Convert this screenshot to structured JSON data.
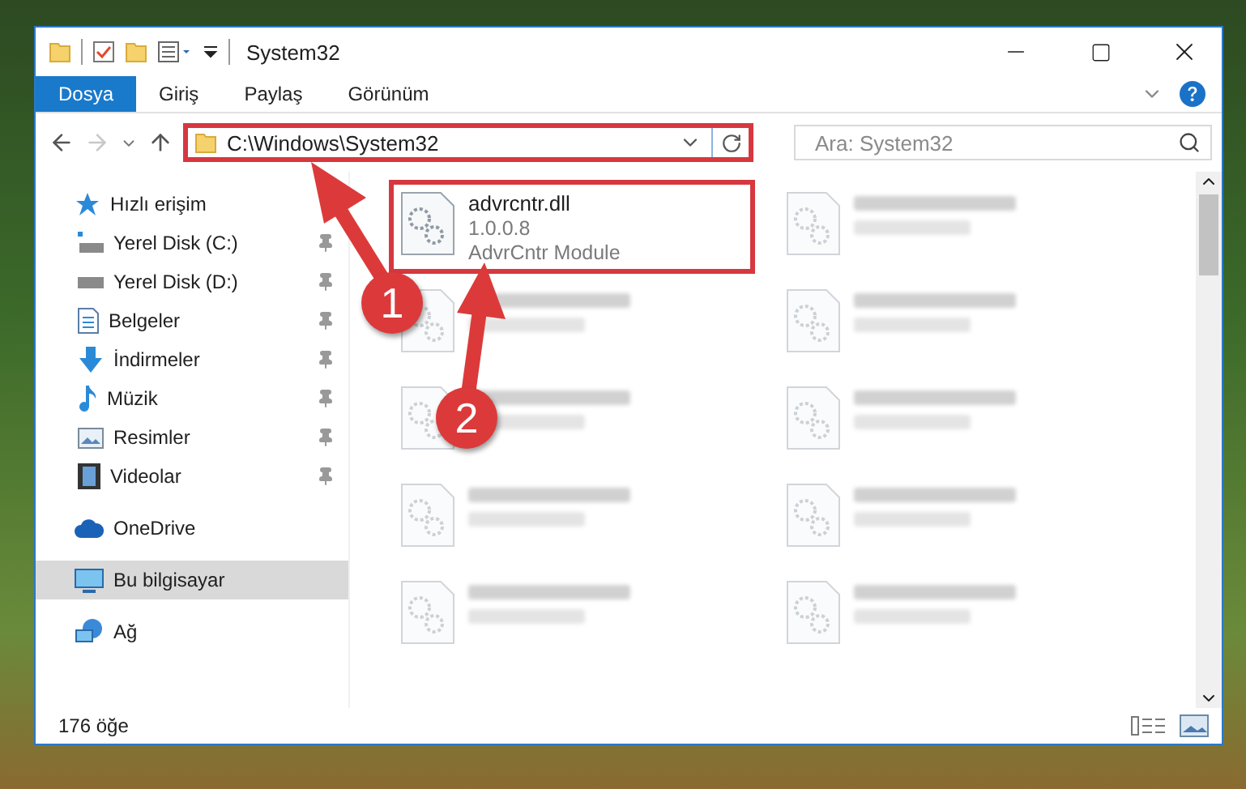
{
  "window": {
    "title": "System32"
  },
  "ribbon_tabs": [
    {
      "label": "Dosya",
      "selected": true
    },
    {
      "label": "Giriş",
      "selected": false
    },
    {
      "label": "Paylaş",
      "selected": false
    },
    {
      "label": "Görünüm",
      "selected": false
    }
  ],
  "address": {
    "value": "C:\\Windows\\System32",
    "highlighted": true
  },
  "search": {
    "placeholder": "Ara: System32"
  },
  "sidebar": {
    "items": [
      {
        "label": "Hızlı erişim",
        "selected": false,
        "children": [
          {
            "label": "Yerel Disk (C:)",
            "pinned": true
          },
          {
            "label": "Yerel Disk (D:)",
            "pinned": true
          },
          {
            "label": "Belgeler",
            "pinned": true
          },
          {
            "label": "İndirmeler",
            "pinned": true
          },
          {
            "label": "Müzik",
            "pinned": true
          },
          {
            "label": "Resimler",
            "pinned": true
          },
          {
            "label": "Videolar",
            "pinned": true
          }
        ]
      },
      {
        "label": "OneDrive",
        "selected": false
      },
      {
        "label": "Bu bilgisayar",
        "selected": true
      },
      {
        "label": "Ağ",
        "selected": false
      }
    ]
  },
  "files": [
    {
      "name": "advrcntr.dll",
      "version": "1.0.0.8",
      "description": "AdvrCntr Module",
      "blurred": false,
      "highlighted": true
    },
    {
      "blurred": true
    },
    {
      "blurred": true
    },
    {
      "blurred": true
    },
    {
      "blurred": true
    },
    {
      "blurred": true
    },
    {
      "blurred": true
    },
    {
      "blurred": true
    },
    {
      "blurred": true
    },
    {
      "blurred": true
    }
  ],
  "status_bar": {
    "count": "176 öğe"
  },
  "annotations": [
    {
      "label": "1"
    },
    {
      "label": "2"
    }
  ]
}
